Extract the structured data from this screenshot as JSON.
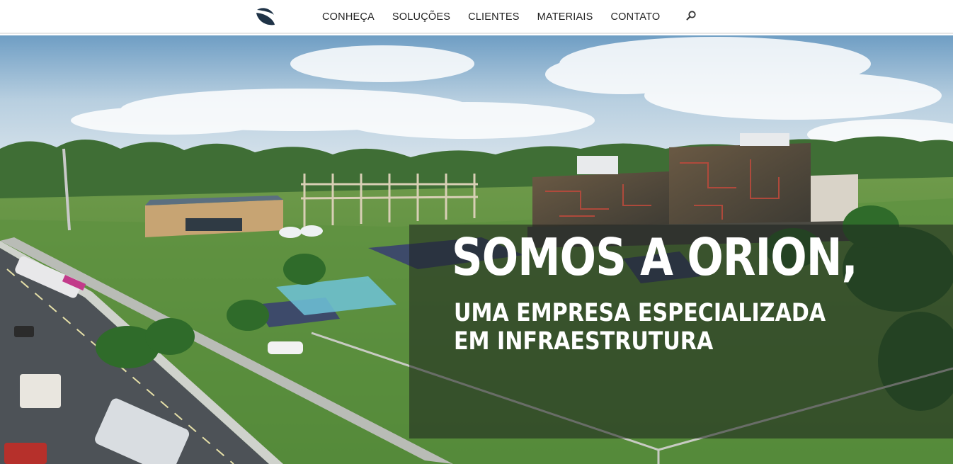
{
  "header": {
    "logo_icon": "orion-leaf-logo-icon",
    "nav": [
      "CONHEÇA",
      "SOLUÇÕES",
      "CLIENTES",
      "MATERIAIS",
      "CONTATO"
    ],
    "search_icon": "search-icon"
  },
  "hero": {
    "headline": "SOMOS A ORION,",
    "subline_1": "UMA EMPRESA ESPECIALIZADA",
    "subline_2": "EM INFRAESTRUTURA"
  },
  "colors": {
    "brand_dark": "#1f3347",
    "overlay": "rgba(28, 32, 30, 0.55)",
    "text_light": "#ffffff"
  }
}
